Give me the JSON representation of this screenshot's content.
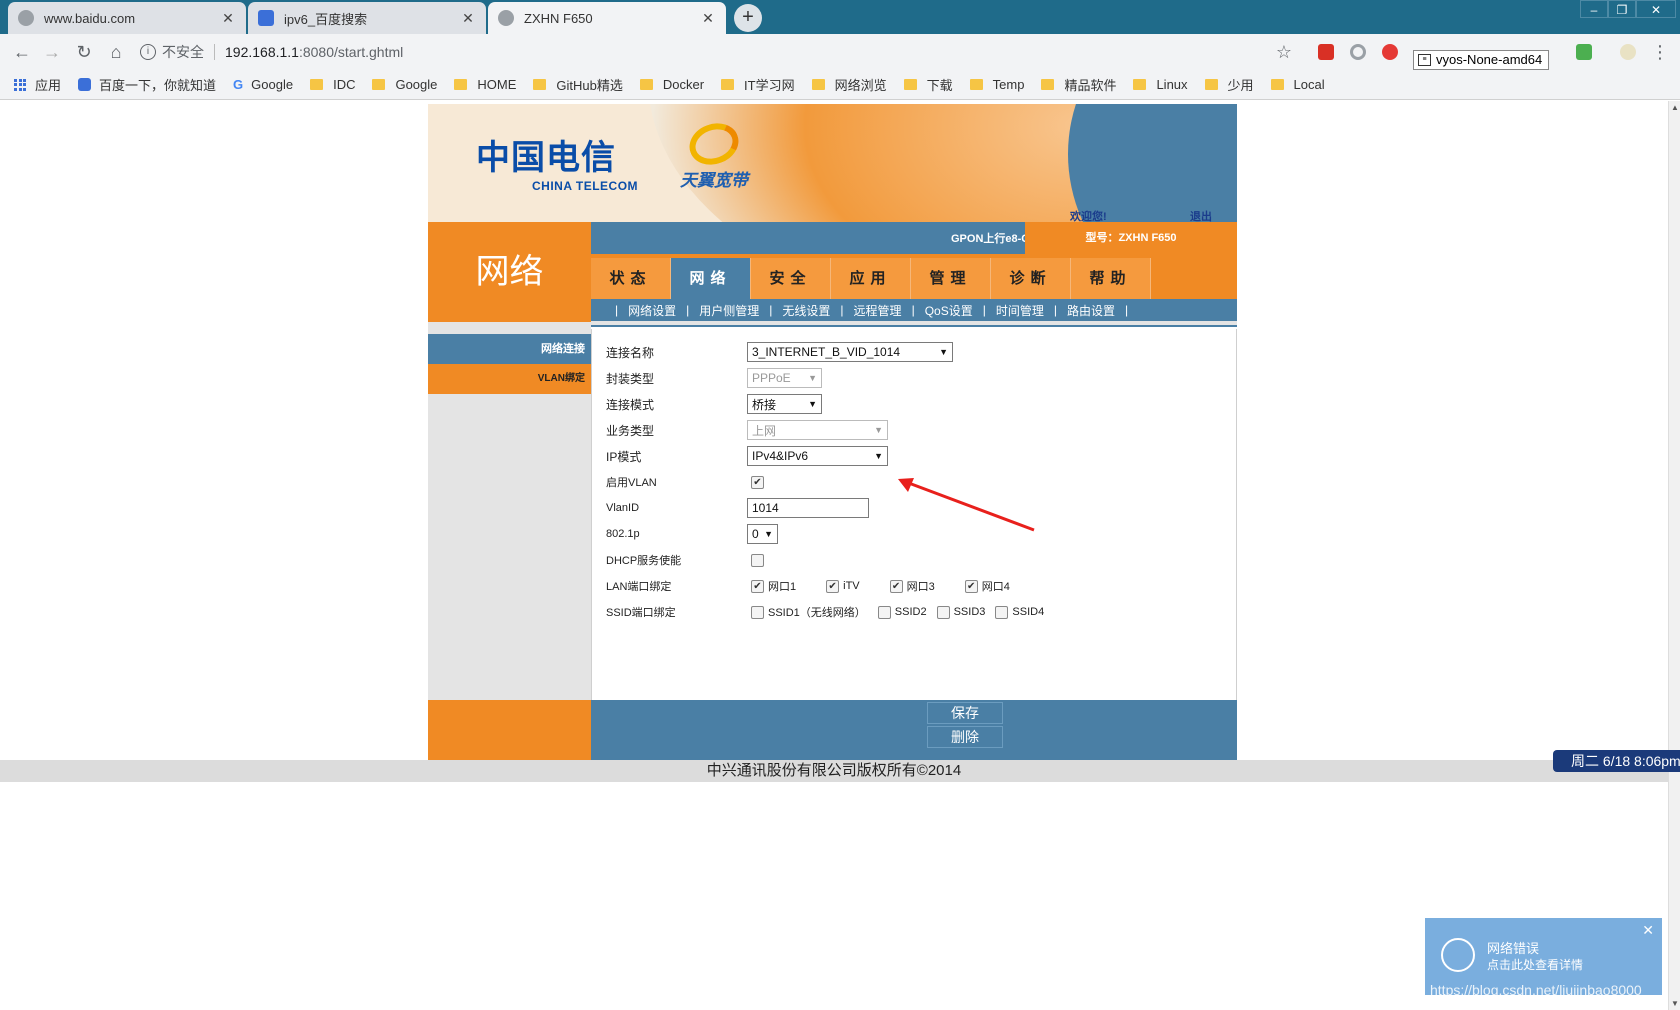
{
  "browser": {
    "tabs": [
      {
        "title": "www.baidu.com"
      },
      {
        "title": "ipv6_百度搜索"
      },
      {
        "title": "ZXHN F650"
      }
    ],
    "new_tab": "+",
    "window_controls": [
      "–",
      "❐",
      "✕"
    ],
    "address": {
      "security": "不安全",
      "host": "192.168.1.1",
      "rest": ":8080/start.ghtml"
    },
    "tooltip": "vyos-None-amd64",
    "bookmarks": [
      "应用",
      "百度一下，你就知道",
      "Google",
      "IDC",
      "Google",
      "HOME",
      "GitHub精选",
      "Docker",
      "IT学习网",
      "网络浏览",
      "下载",
      "Temp",
      "精品软件",
      "Linux",
      "少用",
      "Local"
    ]
  },
  "router": {
    "logo_cn": "中国电信",
    "logo_en": "CHINA TELECOM",
    "logo_ty": "天翼宽带",
    "welcome": "欢迎您!",
    "logout": "退出",
    "gpon": "GPON上行e8-C",
    "model": "型号：ZXHN F650",
    "section": "网络",
    "menus": [
      "状态",
      "网络",
      "安全",
      "应用",
      "管理",
      "诊断",
      "帮助"
    ],
    "active_menu": 1,
    "submenu": [
      "网络设置",
      "用户侧管理",
      "无线设置",
      "远程管理",
      "QoS设置",
      "时间管理",
      "路由设置"
    ],
    "sidebar": [
      "网络连接",
      "VLAN绑定"
    ],
    "form": {
      "conn_name_label": "连接名称",
      "conn_name": "3_INTERNET_B_VID_1014",
      "encap_label": "封装类型",
      "encap": "PPPoE",
      "conn_mode_label": "连接模式",
      "conn_mode": "桥接",
      "service_label": "业务类型",
      "service": "上网",
      "ip_mode_label": "IP模式",
      "ip_mode": "IPv4&IPv6",
      "vlan_enable_label": "启用VLAN",
      "vlan_id_label": "VlanID",
      "vlan_id": "1014",
      "dot1p_label": "802.1p",
      "dot1p": "0",
      "dhcp_label": "DHCP服务使能",
      "lan_bind_label": "LAN端口绑定",
      "lan_ports": [
        "网口1",
        "iTV",
        "网口3",
        "网口4"
      ],
      "ssid_bind_label": "SSID端口绑定",
      "ssids": [
        "SSID1（无线网络）",
        "SSID2",
        "SSID3",
        "SSID4"
      ]
    },
    "save": "保存",
    "delete": "删除",
    "copyright": "中兴通讯股份有限公司版权所有©2014"
  },
  "taskbar_clock": "周二 6/18  8:06pm",
  "toast": {
    "title": "网络错误",
    "subtitle": "点击此处查看详情",
    "close": "✕"
  },
  "watermark": "https://blog.csdn.net/liujinbao8000"
}
